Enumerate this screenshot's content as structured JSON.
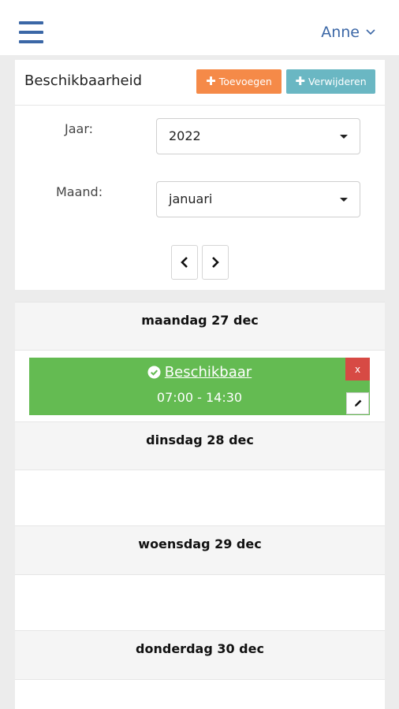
{
  "header": {
    "user_name": "Anne"
  },
  "availability": {
    "title": "Beschikbaarheid",
    "add_label": "Toevoegen",
    "remove_label": "Verwijderen",
    "year_label": "Jaar:",
    "year_value": "2022",
    "month_label": "Maand:",
    "month_value": "januari"
  },
  "days": [
    {
      "label": "maandag 27 dec",
      "event": {
        "title": "Beschikbaar",
        "time": "07:00 - 14:30",
        "close_label": "x"
      }
    },
    {
      "label": "dinsdag 28 dec"
    },
    {
      "label": "woensdag 29 dec"
    },
    {
      "label": "donderdag 30 dec"
    }
  ],
  "colors": {
    "brand_blue": "#3b67a6",
    "add_orange": "#f58a48",
    "remove_teal": "#6ab7c3",
    "available_green": "#64bb52",
    "close_red": "#d74a44"
  }
}
